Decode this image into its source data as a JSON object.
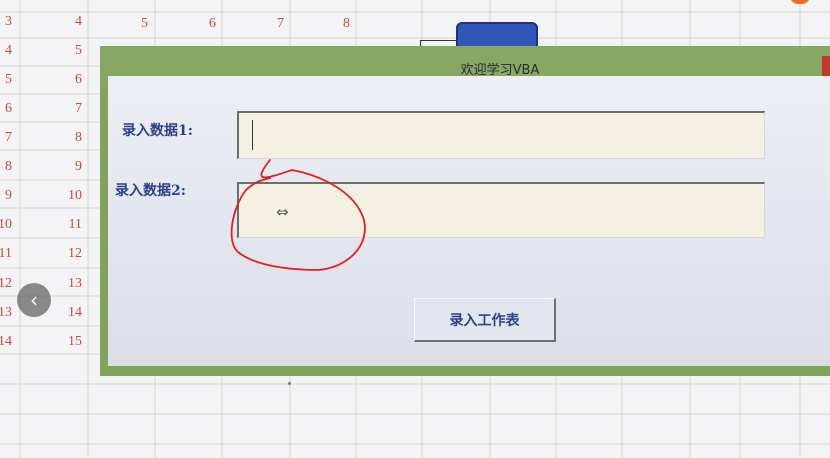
{
  "window": {
    "title": "欢迎学习VBA"
  },
  "form": {
    "field1_label": "录入数据1:",
    "field1_value": "",
    "field2_label": "录入数据2:",
    "field2_value": "",
    "submit_label": "录入工作表"
  },
  "sheet": {
    "col_a": [
      "3",
      "4",
      "5",
      "6",
      "7",
      "8",
      "9",
      "10",
      "11",
      "12",
      "13",
      "14"
    ],
    "col_b": [
      "4",
      "5",
      "6",
      "7",
      "8",
      "9",
      "10",
      "11",
      "12",
      "13",
      "14",
      "15"
    ],
    "row0_extra": [
      "5",
      "6",
      "7",
      "8"
    ]
  },
  "icons": {
    "back": "chevron-left-icon",
    "cursor": "resize-horizontal-icon"
  },
  "colors": {
    "cell_text": "#c64a3a",
    "form_frame": "#7fa35c",
    "label_text": "#2e3f8a",
    "shape_fill": "#2f56b8",
    "annotation": "#e02020"
  }
}
